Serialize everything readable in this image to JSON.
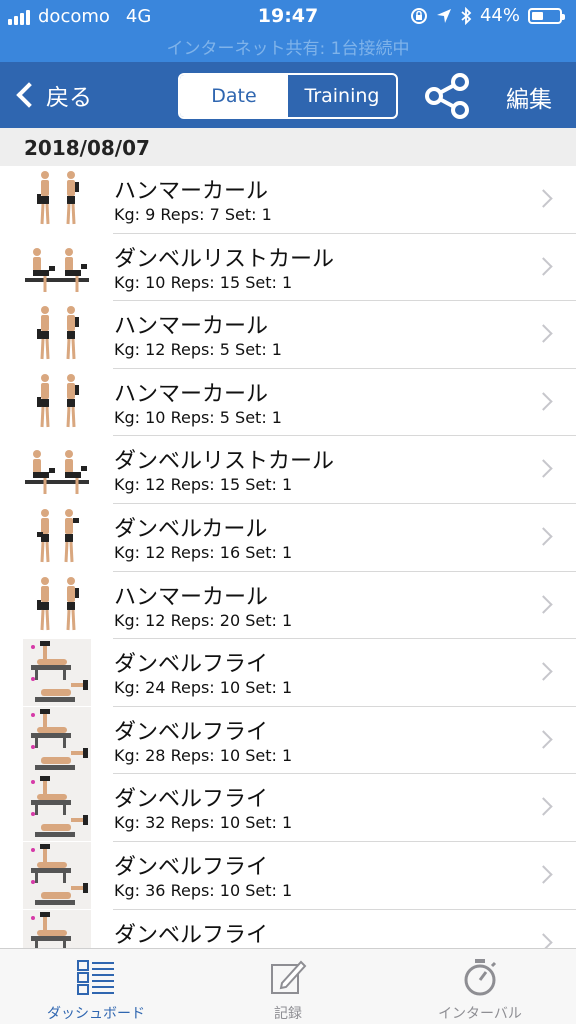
{
  "status_bar": {
    "carrier": "docomo",
    "network": "4G",
    "time": "19:47",
    "battery": "44%",
    "battery_level": 0.44,
    "tethering": "インターネット共有: 1台接続中"
  },
  "nav": {
    "back_label": "戻る",
    "segments": [
      "Date",
      "Training"
    ],
    "active_segment": "Date",
    "edit_label": "編集"
  },
  "section": {
    "date": "2018/08/07"
  },
  "entries": [
    {
      "name": "ハンマーカール",
      "detail": "Kg: 9 Reps: 7 Set: 1",
      "icon": "hammer-curl"
    },
    {
      "name": "ダンベルリストカール",
      "detail": "Kg: 10 Reps: 15 Set: 1",
      "icon": "wrist-curl"
    },
    {
      "name": "ハンマーカール",
      "detail": "Kg: 12 Reps: 5 Set: 1",
      "icon": "hammer-curl"
    },
    {
      "name": "ハンマーカール",
      "detail": "Kg: 10 Reps: 5 Set: 1",
      "icon": "hammer-curl"
    },
    {
      "name": "ダンベルリストカール",
      "detail": "Kg: 12 Reps: 15 Set: 1",
      "icon": "wrist-curl"
    },
    {
      "name": "ダンベルカール",
      "detail": "Kg: 12 Reps: 16 Set: 1",
      "icon": "dumbbell-curl"
    },
    {
      "name": "ハンマーカール",
      "detail": "Kg: 12 Reps: 20 Set: 1",
      "icon": "hammer-curl"
    },
    {
      "name": "ダンベルフライ",
      "detail": "Kg: 24 Reps: 10 Set: 1",
      "icon": "dumbbell-fly"
    },
    {
      "name": "ダンベルフライ",
      "detail": "Kg: 28 Reps: 10 Set: 1",
      "icon": "dumbbell-fly"
    },
    {
      "name": "ダンベルフライ",
      "detail": "Kg: 32 Reps: 10 Set: 1",
      "icon": "dumbbell-fly"
    },
    {
      "name": "ダンベルフライ",
      "detail": "Kg: 36 Reps: 10 Set: 1",
      "icon": "dumbbell-fly"
    },
    {
      "name": "ダンベルフライ",
      "detail": "",
      "icon": "dumbbell-fly"
    }
  ],
  "tabs": [
    {
      "label": "ダッシュボード",
      "icon": "dashboard-icon",
      "active": true
    },
    {
      "label": "記録",
      "icon": "record-edit-icon",
      "active": false
    },
    {
      "label": "インターバル",
      "icon": "stopwatch-icon",
      "active": false
    }
  ],
  "colors": {
    "status_bar": "#3a86dc",
    "nav_bar": "#2f66b0",
    "active_tab": "#2f66b0",
    "inactive_tab": "#8e8e93"
  }
}
